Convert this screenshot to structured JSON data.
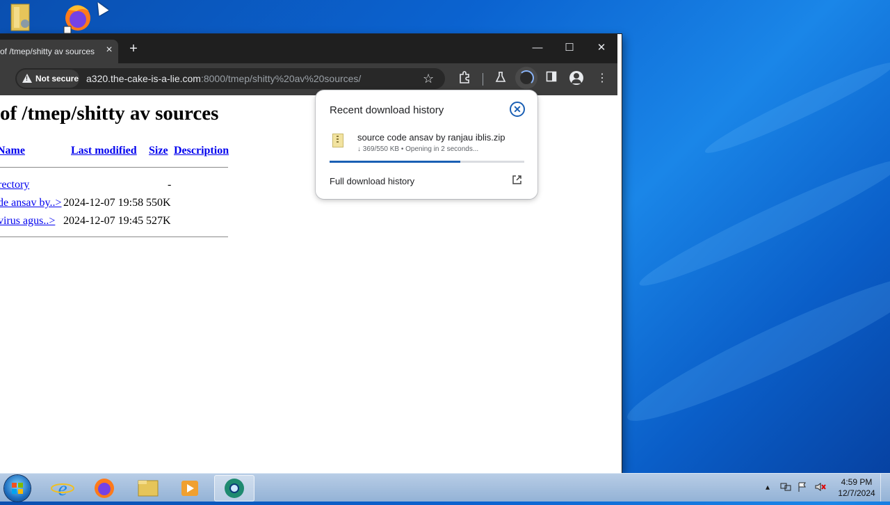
{
  "desktop": {
    "icons": [
      "folder-icon",
      "firefox-icon"
    ]
  },
  "browser": {
    "tab_title": "of /tmep/shitty av sources",
    "tab_close": "×",
    "new_tab": "+",
    "window_controls": {
      "minimize": "—",
      "maximize": "☐",
      "close": "✕"
    },
    "security_label": "Not secure",
    "url_host": "a320.the-cake-is-a-lie.com",
    "url_path": ":8000/tmep/shitty%20av%20sources/",
    "accent": "#1a5fb4"
  },
  "page": {
    "heading": "of /tmep/shitty av sources",
    "columns": {
      "name": "Name",
      "last_modified": "Last modified",
      "size": "Size",
      "description": "Description"
    },
    "rows": [
      {
        "name": "rectory",
        "date": "",
        "size": "-"
      },
      {
        "name": "de ansav by..>",
        "date": "2024-12-07 19:58",
        "size": "550K"
      },
      {
        "name": "virus agus..>",
        "date": "2024-12-07 19:45",
        "size": "527K"
      }
    ]
  },
  "download_bubble": {
    "title": "Recent download history",
    "file_name": "source code ansav by ranjau iblis.zip",
    "status": "↓ 369/550 KB • Opening in 2 seconds...",
    "progress_fraction": 0.67,
    "full_history_label": "Full download history"
  },
  "taskbar": {
    "apps": [
      "internet-explorer",
      "firefox",
      "file-explorer",
      "media-player",
      "chrome-canary"
    ],
    "clock_time": "4:59 PM",
    "clock_date": "12/7/2024"
  }
}
